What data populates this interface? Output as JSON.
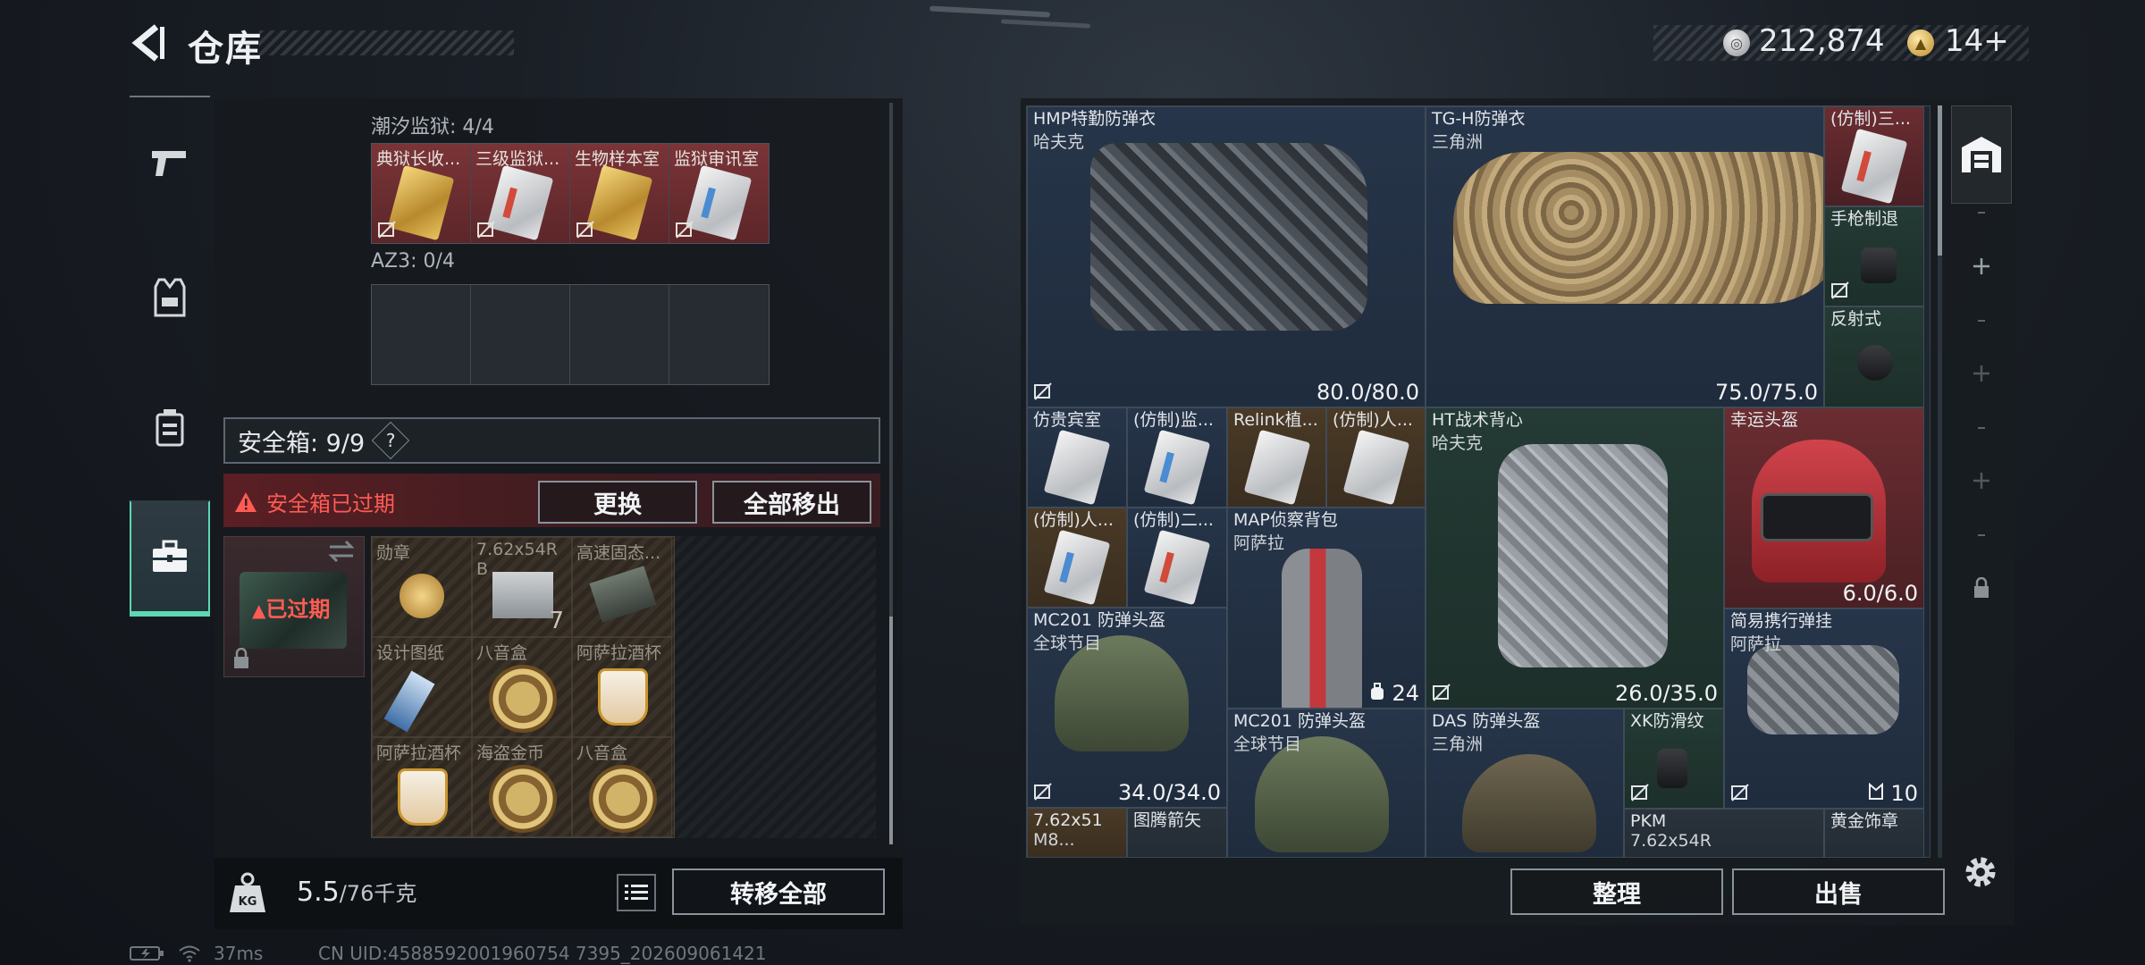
{
  "header": {
    "title": "仓库"
  },
  "currency": {
    "money": "212,874",
    "tickets": "14+"
  },
  "nav": {
    "items": [
      "weapons",
      "gear",
      "consumables",
      "safe-case"
    ],
    "active": "safe-case"
  },
  "storage": {
    "tidal_prison_label": "潮汐监狱: 4/4",
    "tidal_items": [
      "典狱长收...",
      "三级监狱...",
      "生物样本室",
      "监狱审讯室"
    ],
    "az3_label": "AZ3: 0/4"
  },
  "safe": {
    "title": "安全箱: 9/9",
    "help": "?",
    "expired_notice": "安全箱已过期",
    "replace_label": "更换",
    "move_all_label": "全部移出",
    "case_status": "已过期",
    "items": [
      {
        "name": "勋章"
      },
      {
        "name": "7.62x54R B",
        "count": "7"
      },
      {
        "name": "高速固态..."
      },
      {
        "name": "设计图纸"
      },
      {
        "name": "八音盒"
      },
      {
        "name": "阿萨拉酒杯"
      },
      {
        "name": "阿萨拉酒杯"
      },
      {
        "name": "海盗金币"
      },
      {
        "name": "八音盒"
      }
    ]
  },
  "weight": {
    "current": "5.5",
    "max": "/76千克",
    "transfer_label": "转移全部"
  },
  "stash": {
    "items": [
      {
        "name": "HMP特勤防弹衣",
        "maker": "哈夫克",
        "durability": "80.0/80.0"
      },
      {
        "name": "TG-H防弹衣",
        "maker": "三角洲",
        "durability": "75.0/75.0"
      },
      {
        "name": "(仿制)三..."
      },
      {
        "name": "手枪制退"
      },
      {
        "name": "反射式"
      },
      {
        "name": "仿贵宾室"
      },
      {
        "name": "(仿制)监..."
      },
      {
        "name": "Relink植..."
      },
      {
        "name": "(仿制)人..."
      },
      {
        "name": "HT战术背心",
        "maker": "哈夫克",
        "durability": "26.0/35.0"
      },
      {
        "name": "幸运头盔",
        "durability": "6.0/6.0"
      },
      {
        "name": "(仿制)人..."
      },
      {
        "name": "(仿制)二..."
      },
      {
        "name": "MAP侦察背包",
        "maker": "阿萨拉",
        "count": "24"
      },
      {
        "name": "MC201 防弹头盔",
        "maker": "全球节目",
        "durability": "34.0/34.0"
      },
      {
        "name": "简易携行弹挂",
        "maker": "阿萨拉",
        "count": "10"
      },
      {
        "name": "MC201 防弹头盔",
        "maker": "全球节目"
      },
      {
        "name": "DAS 防弹头盔",
        "maker": "三角洲"
      },
      {
        "name": "XK防滑纹"
      },
      {
        "name": "7.62x51",
        "sub": "M8..."
      },
      {
        "name": "图腾箭矢"
      },
      {
        "name": "PKM",
        "sub": "7.62x54R"
      },
      {
        "name": "黄金饰章"
      }
    ],
    "sort_label": "整理",
    "sell_label": "出售"
  },
  "status": {
    "ping": "37ms",
    "uid": "CN UID:4588592001960754 7395_202609061421"
  },
  "colors": {
    "accent_green": "#5fd6b4",
    "expired_red": "#ff5b54",
    "rare_red": "#6b2d31",
    "gold": "#4a3a26"
  }
}
